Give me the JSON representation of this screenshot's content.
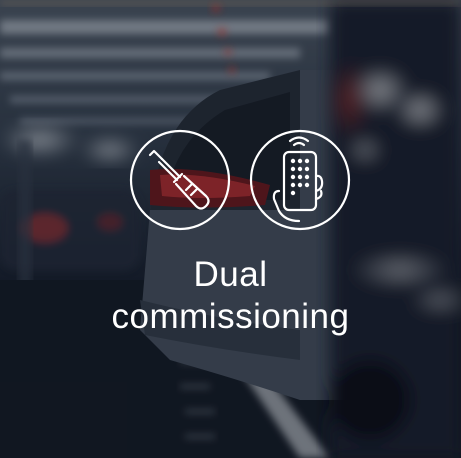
{
  "card": {
    "title_line1": "Dual",
    "title_line2": "commissioning"
  },
  "icons": [
    "screwdriver-icon",
    "remote-control-icon"
  ],
  "colors": {
    "text": "#ffffff",
    "icon_stroke": "#ffffff",
    "overlay": "#0a1018"
  }
}
